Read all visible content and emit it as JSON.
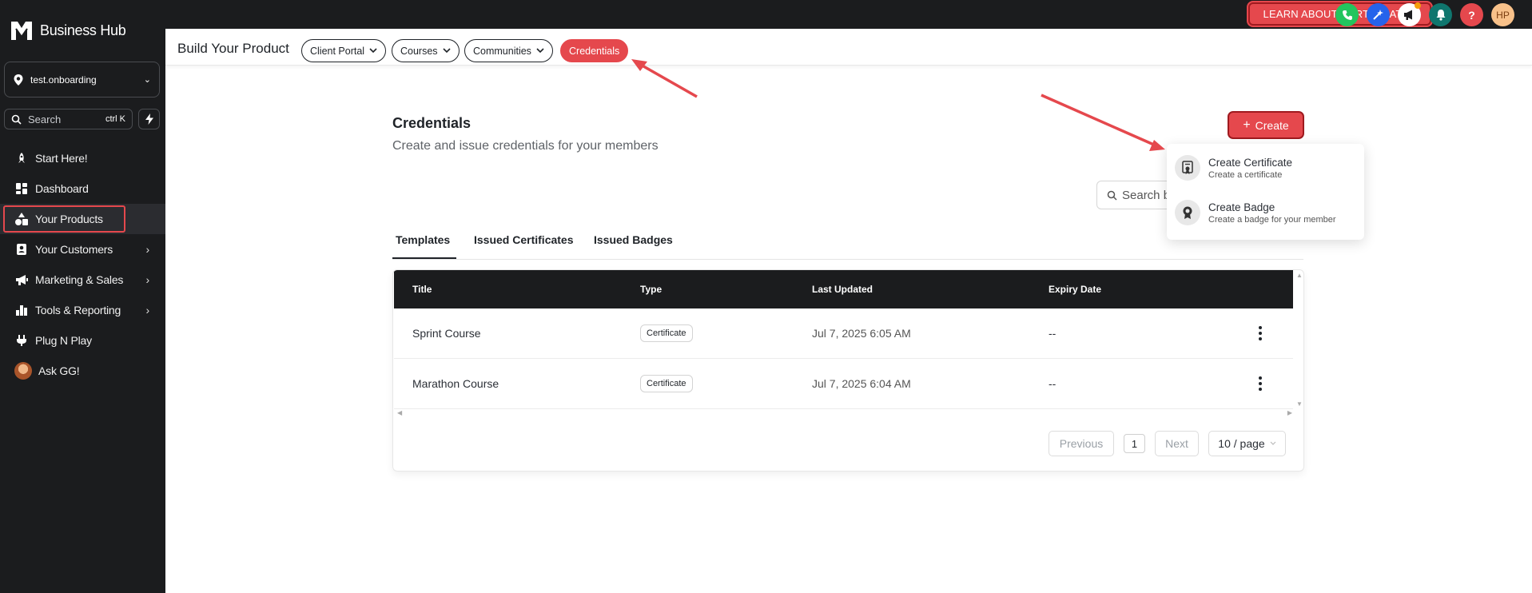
{
  "brand": {
    "name": "Business Hub"
  },
  "sidebar": {
    "location": "test.onboarding",
    "search_placeholder": "Search",
    "search_shortcut": "ctrl K",
    "items": [
      {
        "label": "Start Here!",
        "icon": "rocket-icon",
        "has_arrow": false
      },
      {
        "label": "Dashboard",
        "icon": "dashboard-icon",
        "has_arrow": false
      },
      {
        "label": "Your Products",
        "icon": "shapes-icon",
        "has_arrow": false,
        "active": true
      },
      {
        "label": "Your Customers",
        "icon": "contact-icon",
        "has_arrow": true
      },
      {
        "label": "Marketing & Sales",
        "icon": "megaphone-icon",
        "has_arrow": true
      },
      {
        "label": "Tools & Reporting",
        "icon": "bar-chart-icon",
        "has_arrow": true
      },
      {
        "label": "Plug N Play",
        "icon": "plug-icon",
        "has_arrow": false
      },
      {
        "label": "Ask GG!",
        "icon": "avatar-icon",
        "has_arrow": false
      }
    ]
  },
  "topbar": {
    "learn_button": "LEARN ABOUT CERTIFICATES",
    "icons": [
      "phone-icon",
      "ai-sparkle-icon",
      "megaphone-icon",
      "bell-icon",
      "help-icon"
    ],
    "user_initials": "HP",
    "colors": {
      "phone": "#22c55e",
      "ai": "#2563eb",
      "announce": "#ffffff",
      "bell": "#0f766e",
      "help": "#e5484d",
      "avatar": "#f8c18a"
    }
  },
  "subheader": {
    "title": "Build Your Product",
    "pills": [
      "Client Portal",
      "Courses",
      "Communities",
      "Credentials"
    ],
    "active_pill": "Credentials"
  },
  "page": {
    "title": "Credentials",
    "subtitle": "Create and issue credentials for your members",
    "create_button": "Create",
    "search_placeholder": "Search b"
  },
  "create_menu": {
    "items": [
      {
        "title": "Create Certificate",
        "description": "Create a certificate",
        "icon": "certificate-icon"
      },
      {
        "title": "Create Badge",
        "description": "Create a badge for your member",
        "icon": "badge-icon"
      }
    ]
  },
  "tabs": [
    "Templates",
    "Issued Certificates",
    "Issued Badges"
  ],
  "table": {
    "columns": [
      "Title",
      "Type",
      "Last Updated",
      "Expiry Date"
    ],
    "rows": [
      {
        "title": "Sprint Course",
        "type": "Certificate",
        "updated": "Jul 7, 2025 6:05 AM",
        "expiry": "--"
      },
      {
        "title": "Marathon Course",
        "type": "Certificate",
        "updated": "Jul 7, 2025 6:04 AM",
        "expiry": "--"
      }
    ]
  },
  "pagination": {
    "previous": "Previous",
    "page": "1",
    "next": "Next",
    "page_size": "10 / page"
  },
  "accent_color": "#e5484d"
}
